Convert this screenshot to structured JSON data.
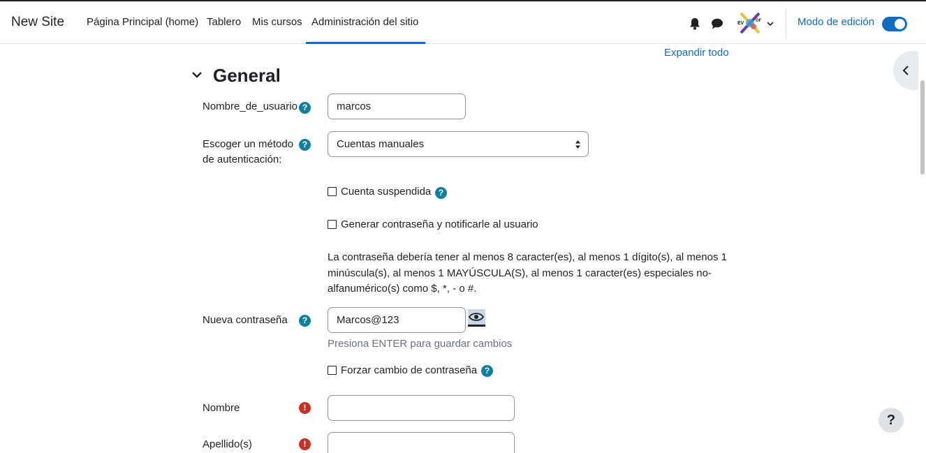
{
  "navbar": {
    "site_name": "New Site",
    "items": [
      {
        "label": "Página Principal (home)"
      },
      {
        "label": "Tablero"
      },
      {
        "label": "Mis cursos"
      },
      {
        "label": "Administración del sitio",
        "active": true
      }
    ],
    "icons": [
      "bell-icon",
      "chat-icon",
      "user-avatar",
      "chevron-down-icon"
    ],
    "edit_mode_label": "Modo de edición",
    "edit_mode_on": true
  },
  "main": {
    "expand_all": "Expandir todo",
    "section_title": "General",
    "fields": {
      "username": {
        "label": "Nombre_de_usuario",
        "value": "marcos"
      },
      "auth": {
        "label": "Escoger un método de autenticación:",
        "value": "Cuentas manuales"
      },
      "suspended": {
        "label": "Cuenta suspendida",
        "checked": false
      },
      "generate_password": {
        "label": "Generar contraseña y notificarle al usuario",
        "checked": false
      },
      "password_policy": "La contraseña debería tener al menos 8 caracter(es), al menos 1 dígito(s), al menos 1 minúscula(s), al menos 1 MAYÚSCULA(S), al menos 1 caracter(es) especiales no-alfanumérico(s) como $, *, - o #.",
      "new_password": {
        "label": "Nueva contraseña",
        "value": "Marcos@123",
        "hint": "Presiona ENTER para guardar cambios"
      },
      "force_change": {
        "label": "Forzar cambio de contraseña",
        "checked": false
      },
      "first_name": {
        "label": "Nombre",
        "value": ""
      },
      "last_name": {
        "label": "Apellido(s)",
        "value": ""
      }
    },
    "help_glyph": "?",
    "required_glyph": "!"
  },
  "colors": {
    "accent": "#0f6cbf",
    "help": "#0f7fa0",
    "required": "#ca3120"
  }
}
